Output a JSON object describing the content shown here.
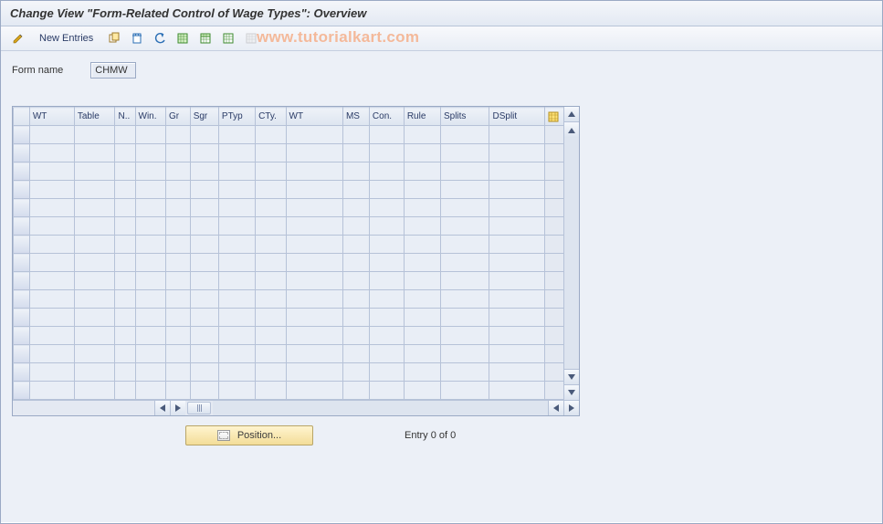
{
  "title": "Change View \"Form-Related Control of Wage Types\": Overview",
  "watermark": "www.tutorialkart.com",
  "toolbar": {
    "new_entries_label": "New Entries"
  },
  "form": {
    "form_name_label": "Form name",
    "form_name_value": "CHMW"
  },
  "table": {
    "columns": [
      "WT",
      "Table",
      "N..",
      "Win.",
      "Gr",
      "Sgr",
      "PTyp",
      "CTy.",
      "WT",
      "MS",
      "Con.",
      "Rule",
      "Splits",
      "DSplit"
    ],
    "row_count": 15
  },
  "footer": {
    "position_label": "Position...",
    "entry_text": "Entry 0 of 0"
  }
}
